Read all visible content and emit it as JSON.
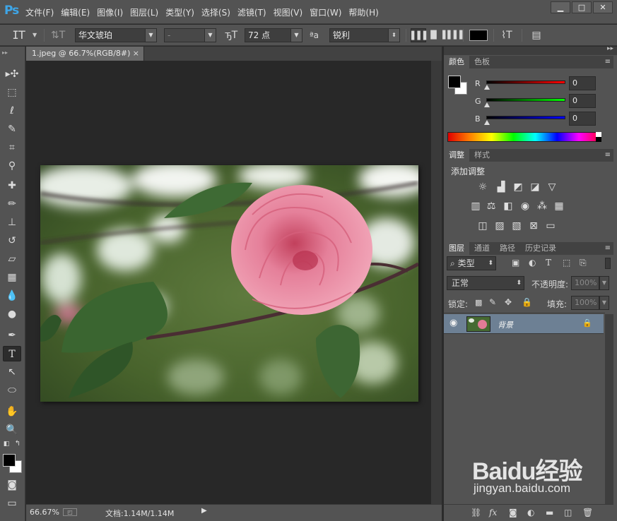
{
  "app": {
    "logo": "Ps"
  },
  "menu": [
    "文件(F)",
    "编辑(E)",
    "图像(I)",
    "图层(L)",
    "类型(Y)",
    "选择(S)",
    "滤镜(T)",
    "视图(V)",
    "窗口(W)",
    "帮助(H)"
  ],
  "window_buttons": {
    "minimize": "▁",
    "maximize": "□",
    "close": "✕"
  },
  "options": {
    "font_family": "华文琥珀",
    "font_style": "-",
    "font_size": "72 点",
    "aa_label": "ªa",
    "antialias": "锐利"
  },
  "document": {
    "tab_title": "1.jpeg @ 66.7%(RGB/8#)",
    "close": "×",
    "zoom": "66.67%",
    "doc_info": "文档:1.14M/1.14M"
  },
  "color_panel": {
    "tabs": [
      "颜色",
      "色板"
    ],
    "channels": [
      {
        "label": "R",
        "value": "0",
        "color": "#ff0000"
      },
      {
        "label": "G",
        "value": "0",
        "color": "#00ff00"
      },
      {
        "label": "B",
        "value": "0",
        "color": "#0000ff"
      }
    ]
  },
  "adjust_panel": {
    "tabs": [
      "调整",
      "样式"
    ],
    "title": "添加调整"
  },
  "layers_panel": {
    "tabs": [
      "图层",
      "通道",
      "路径",
      "历史记录"
    ],
    "filter": "类型",
    "blend_mode": "正常",
    "opacity_label": "不透明度:",
    "opacity_value": "100%",
    "lock_label": "锁定:",
    "fill_label": "填充:",
    "fill_value": "100%",
    "layers": [
      {
        "name": "背景"
      }
    ]
  },
  "watermark": {
    "brand": "Baidu经验",
    "url": "jingyan.baidu.com"
  },
  "colors": {
    "chrome": "#535353",
    "canvas": "#282828",
    "selected_layer": "#6d8094",
    "ps_blue": "#3ea6e8"
  }
}
